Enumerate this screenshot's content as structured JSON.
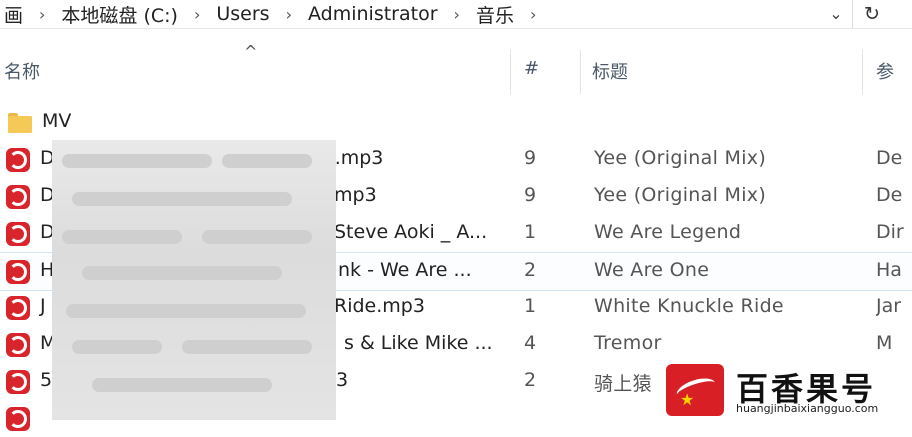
{
  "address_bar": {
    "lead": "画",
    "crumbs": [
      "本地磁盘 (C:)",
      "Users",
      "Administrator",
      "音乐"
    ],
    "dropdown_icon": "chevron-down-icon",
    "refresh_icon": "refresh-icon"
  },
  "columns": {
    "name": "名称",
    "number": "#",
    "title": "标题",
    "artist": "参"
  },
  "rows": [
    {
      "type": "folder",
      "name": "MV",
      "num": "",
      "title": "",
      "artist": ""
    },
    {
      "type": "mp3",
      "name": "D",
      "tail": "l).mp3",
      "num": "9",
      "title": "Yee (Original Mix)",
      "artist": "De"
    },
    {
      "type": "mp3",
      "name": "D",
      "tail": "mp3",
      "num": "9",
      "title": "Yee (Original Mix)",
      "artist": "De"
    },
    {
      "type": "mp3",
      "name": "D",
      "tail": "Steve Aoki _ A...",
      "num": "1",
      "title": "We Are Legend",
      "artist": "Dir"
    },
    {
      "type": "mp3",
      "name": "H",
      "tail": "nk - We Are ...",
      "num": "2",
      "title": "We Are One",
      "artist": "Ha"
    },
    {
      "type": "mp3",
      "name": "J",
      "tail": "Ride.mp3",
      "num": "1",
      "title": "White Knuckle Ride",
      "artist": "Jar"
    },
    {
      "type": "mp3",
      "name": "M",
      "tail": "s & Like Mike ...",
      "num": "4",
      "title": "Tremor",
      "artist": "M"
    },
    {
      "type": "mp3",
      "name": "5",
      "tail": "3",
      "num": "2",
      "title": "骑上猿",
      "artist": ""
    }
  ],
  "watermark": {
    "brand": "百香果号",
    "url": "huangjinbaixiangguo.com"
  }
}
